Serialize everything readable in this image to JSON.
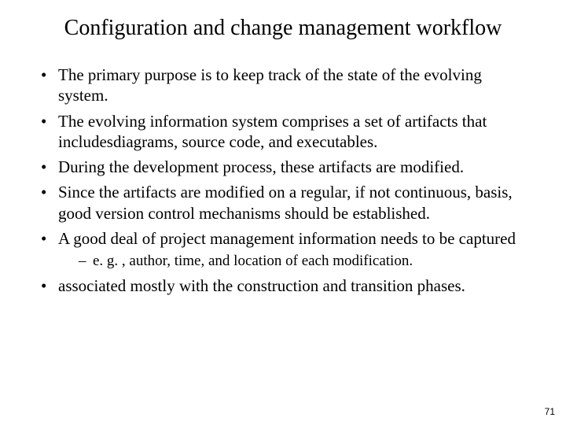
{
  "title": "Configuration and change management workflow",
  "bullets": [
    {
      "text": "The primary purpose is to keep track of the state of the evolving system."
    },
    {
      "text": "The evolving information system comprises a set of artifacts that includesdiagrams, source code, and executables."
    },
    {
      "text": "During the development process, these artifacts are modified."
    },
    {
      "text": "Since the artifacts are modified on a regular, if not continuous, basis, good version control mechanisms should be established."
    },
    {
      "text": "A good deal of project management information needs to be captured",
      "sub": [
        "e. g. , author, time, and location of each modification."
      ]
    },
    {
      "text": "associated mostly with the construction and transition phases."
    }
  ],
  "page_number": "71"
}
